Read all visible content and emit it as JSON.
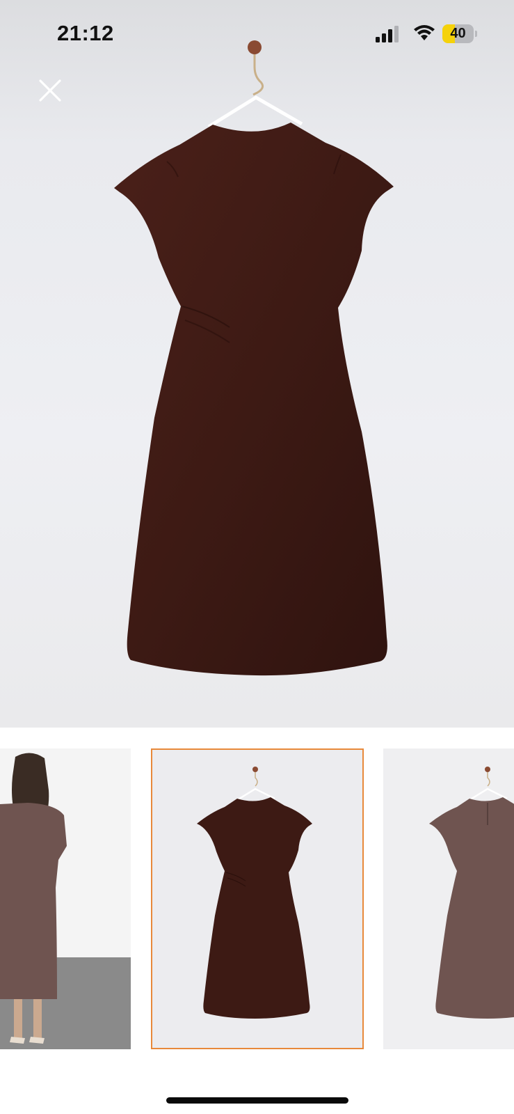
{
  "status_bar": {
    "time": "21:12",
    "battery_level": "40",
    "battery_fraction": 0.4,
    "signal_icon": "cellular-signal-icon",
    "wifi_icon": "wifi-icon"
  },
  "viewer": {
    "close_icon": "close-icon",
    "main_image": "brown-dress-on-hanger-front",
    "selected_thumbnail_index": 1,
    "selected_outline_color": "#e8893a"
  },
  "thumbnails": [
    {
      "name": "model-back-view",
      "selected": false
    },
    {
      "name": "dress-on-hanger-front",
      "selected": true
    },
    {
      "name": "dress-on-hanger-back",
      "selected": false
    }
  ],
  "colors": {
    "dress": "#3d1a14",
    "dress_light": "#6f5450",
    "background": "#eceef1"
  }
}
